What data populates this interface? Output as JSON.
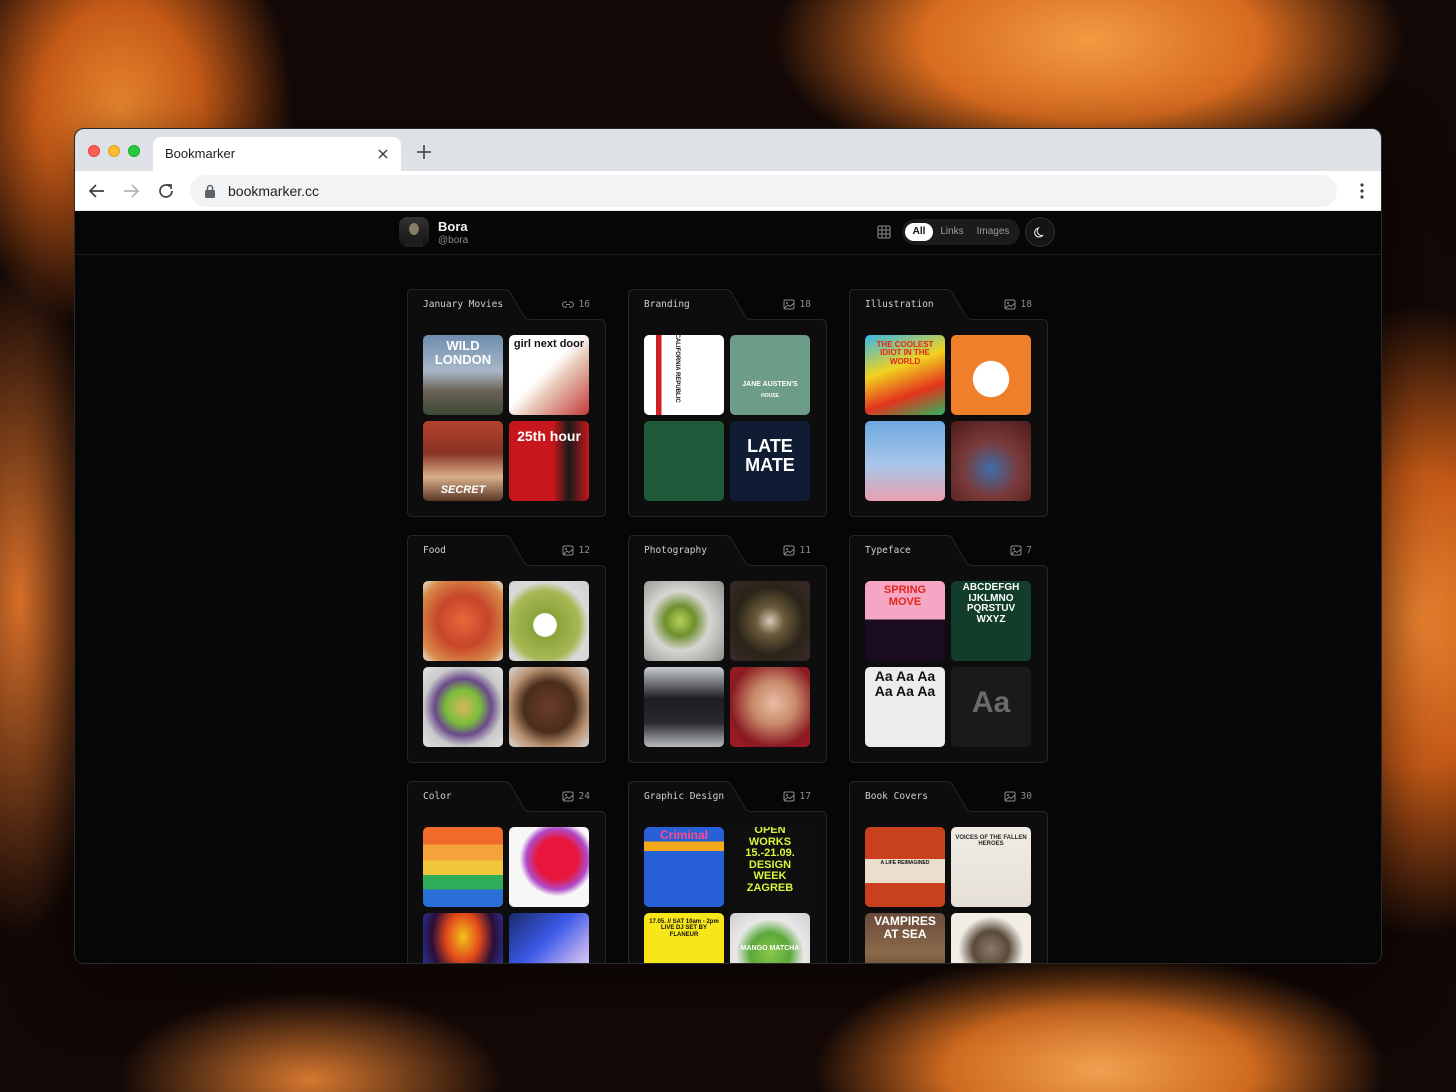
{
  "browser": {
    "tab_title": "Bookmarker",
    "url": "bookmarker.cc"
  },
  "profile": {
    "name": "Bora",
    "handle": "@bora"
  },
  "filter": {
    "options": [
      "All",
      "Links",
      "Images"
    ],
    "active": "All"
  },
  "folders": [
    {
      "title": "January Movies",
      "count": "16",
      "icon": "link-icon",
      "thumbs": [
        {
          "label": "WILD LONDON"
        },
        {
          "label": "girl next door"
        },
        {
          "label": "SECRET"
        },
        {
          "label": "25th hour"
        }
      ]
    },
    {
      "title": "Branding",
      "count": "18",
      "icon": "image-icon",
      "thumbs": [
        {
          "label": "CALIFORNIA REPUBLIC"
        },
        {
          "label": "JANE AUSTEN'S",
          "sublabel": "HOUSE"
        },
        {
          "label": ""
        },
        {
          "label": "LATE MATE"
        }
      ]
    },
    {
      "title": "Illustration",
      "count": "18",
      "icon": "image-icon",
      "thumbs": [
        {
          "label": "THE COOLEST IDIOT IN THE WORLD"
        },
        {
          "label": ""
        },
        {
          "label": ""
        },
        {
          "label": ""
        }
      ]
    },
    {
      "title": "Food",
      "count": "12",
      "icon": "image-icon",
      "thumbs": [
        {
          "label": ""
        },
        {
          "label": ""
        },
        {
          "label": ""
        },
        {
          "label": ""
        }
      ]
    },
    {
      "title": "Photography",
      "count": "11",
      "icon": "image-icon",
      "thumbs": [
        {
          "label": ""
        },
        {
          "label": ""
        },
        {
          "label": ""
        },
        {
          "label": ""
        }
      ]
    },
    {
      "title": "Typeface",
      "count": "7",
      "icon": "image-icon",
      "thumbs": [
        {
          "label": "SPRING MOVE"
        },
        {
          "label": "ABCDEFGH IJKLMNO PQRSTUV WXYZ"
        },
        {
          "label": "Aa Aa Aa Aa Aa Aa"
        },
        {
          "label": "Aa"
        }
      ]
    },
    {
      "title": "Color",
      "count": "24",
      "icon": "image-icon",
      "thumbs": [
        {
          "label": ""
        },
        {
          "label": ""
        },
        {
          "label": ""
        },
        {
          "label": ""
        }
      ]
    },
    {
      "title": "Graphic Design",
      "count": "17",
      "icon": "image-icon",
      "thumbs": [
        {
          "label": "Criminal"
        },
        {
          "label": "OPEN WORKS 15.-21.09. DESIGN WEEK ZAGREB"
        },
        {
          "label": "17.05. // SAT 10am - 2pm LIVE DJ SET BY FLANEUR"
        },
        {
          "label": "MANGO MATCHA"
        }
      ]
    },
    {
      "title": "Book Covers",
      "count": "30",
      "icon": "image-icon",
      "thumbs": [
        {
          "label": "A LIFE REIMAGINED"
        },
        {
          "label": "VOICES OF THE FALLEN HEROES"
        },
        {
          "label": "VAMPIRES AT SEA"
        },
        {
          "label": ""
        }
      ]
    }
  ],
  "colors": {
    "page_bg": "#060606",
    "folder_bg": "#0d0d0d",
    "folder_border": "#262626",
    "accent_bg": "#f29a42"
  }
}
